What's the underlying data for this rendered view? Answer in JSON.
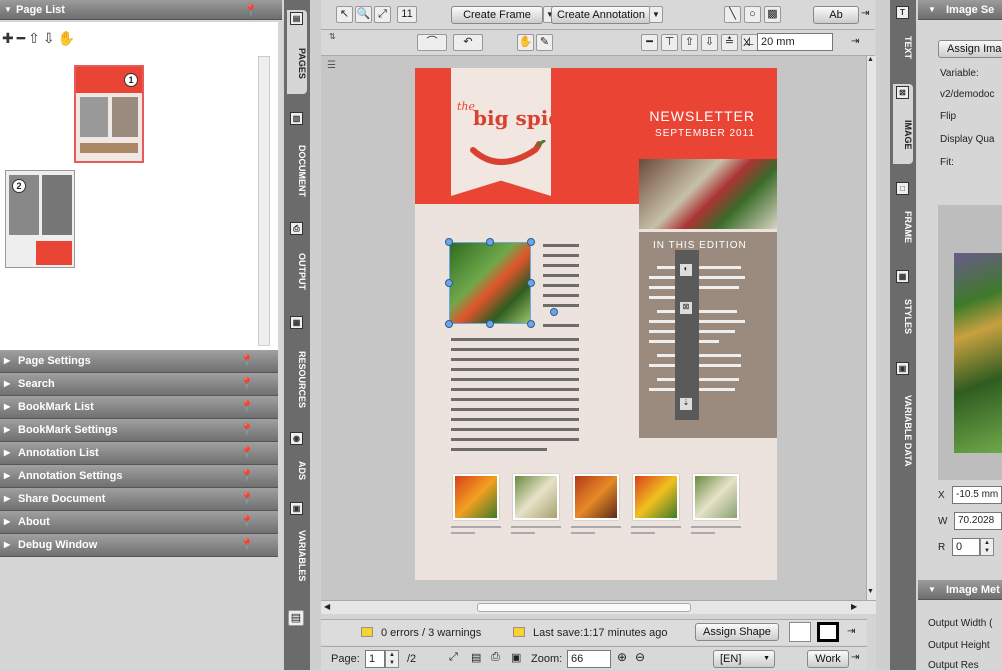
{
  "left_panel": {
    "page_list_title": "Page List",
    "page_numbers": [
      "1",
      "2"
    ],
    "sections": [
      "Page Settings",
      "Search",
      "BookMark List",
      "BookMark Settings",
      "Annotation List",
      "Annotation Settings",
      "Share Document",
      "About",
      "Debug Window"
    ]
  },
  "left_tabs": [
    "PAGES",
    "DOCUMENT",
    "OUTPUT",
    "RESOURCES",
    "ADS",
    "VARIABLES"
  ],
  "toolbar": {
    "create_frame": "Create Frame",
    "create_annotation": "Create Annotation",
    "ab_label": "Ab",
    "x_label": "X",
    "x_value": "20 mm",
    "num_label": "11"
  },
  "document": {
    "brand_the": "the",
    "brand_name": "big spicy",
    "newsletter": "NEWSLETTER",
    "date": "SEPTEMBER 2011",
    "edition_title": "IN THIS EDITION"
  },
  "right_tabs": [
    "TEXT",
    "IMAGE",
    "FRAME",
    "STYLES",
    "VARIABLE DATA"
  ],
  "right_panel": {
    "title": "Image Se",
    "assign_button": "Assign Ima",
    "variable_label": "Variable:",
    "variable_value": "v2/demodoc",
    "flip_label": "Flip",
    "display_quality_label": "Display Qua",
    "fit_label": "Fit:",
    "x_label": "X",
    "x_value": "-10.5 mm",
    "w_label": "W",
    "w_value": "70.2028",
    "r_label": "R",
    "r_value": "0",
    "meta_title": "Image Met",
    "output_width": "Output Width (",
    "output_height": "Output Height",
    "output_res": "Output Res"
  },
  "status": {
    "errors": "0 errors / 3 warnings",
    "last_save": "Last save:1:17 minutes ago",
    "assign_shape": "Assign Shape"
  },
  "bottom": {
    "page_label": "Page:",
    "page_value": "1",
    "page_total": "/2",
    "zoom_label": "Zoom:",
    "zoom_value": "66",
    "lang": "[EN]",
    "work": "Work"
  },
  "colors": {
    "brand_red": "#ea4434",
    "edition_brown": "#9b8b7e",
    "doc_bg": "#ece3de"
  }
}
